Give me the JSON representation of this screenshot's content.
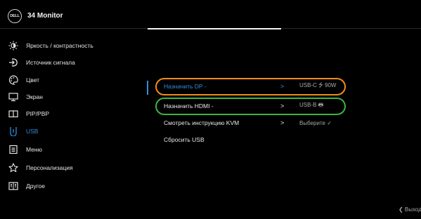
{
  "header": {
    "logo_text": "DELL",
    "title": "34 Monitor"
  },
  "sidebar": {
    "items": [
      {
        "label": "Яркость / контрастность",
        "icon": "brightness-icon"
      },
      {
        "label": "Источник сигнала",
        "icon": "input-source-icon"
      },
      {
        "label": "Цвет",
        "icon": "color-palette-icon"
      },
      {
        "label": "Экран",
        "icon": "monitor-icon"
      },
      {
        "label": "PIP/PBP",
        "icon": "pip-pbp-icon"
      },
      {
        "label": "USB",
        "icon": "usb-icon",
        "active": true
      },
      {
        "label": "Меню",
        "icon": "menu-icon"
      },
      {
        "label": "Персонализация",
        "icon": "star-icon"
      },
      {
        "label": "Другое",
        "icon": "other-icon"
      }
    ]
  },
  "submenu": {
    "items": [
      {
        "label": "Назначить DP -",
        "arrow": ">",
        "value": "USB-C ⭍ 90W",
        "selected": true
      },
      {
        "label": "Назначить HDMI -",
        "arrow": ">",
        "value": "USB-B 🖶"
      },
      {
        "label": "Смотреть инструкцию KVM",
        "arrow": ">",
        "value": "Выберите ✓"
      },
      {
        "label": "Сбросить USB",
        "arrow": "",
        "value": ""
      }
    ]
  },
  "footer": {
    "exit_label": "❮ Выход"
  },
  "colors": {
    "accent": "#2f8fe0",
    "orange": "#f08a1c",
    "green": "#3cb43c"
  }
}
